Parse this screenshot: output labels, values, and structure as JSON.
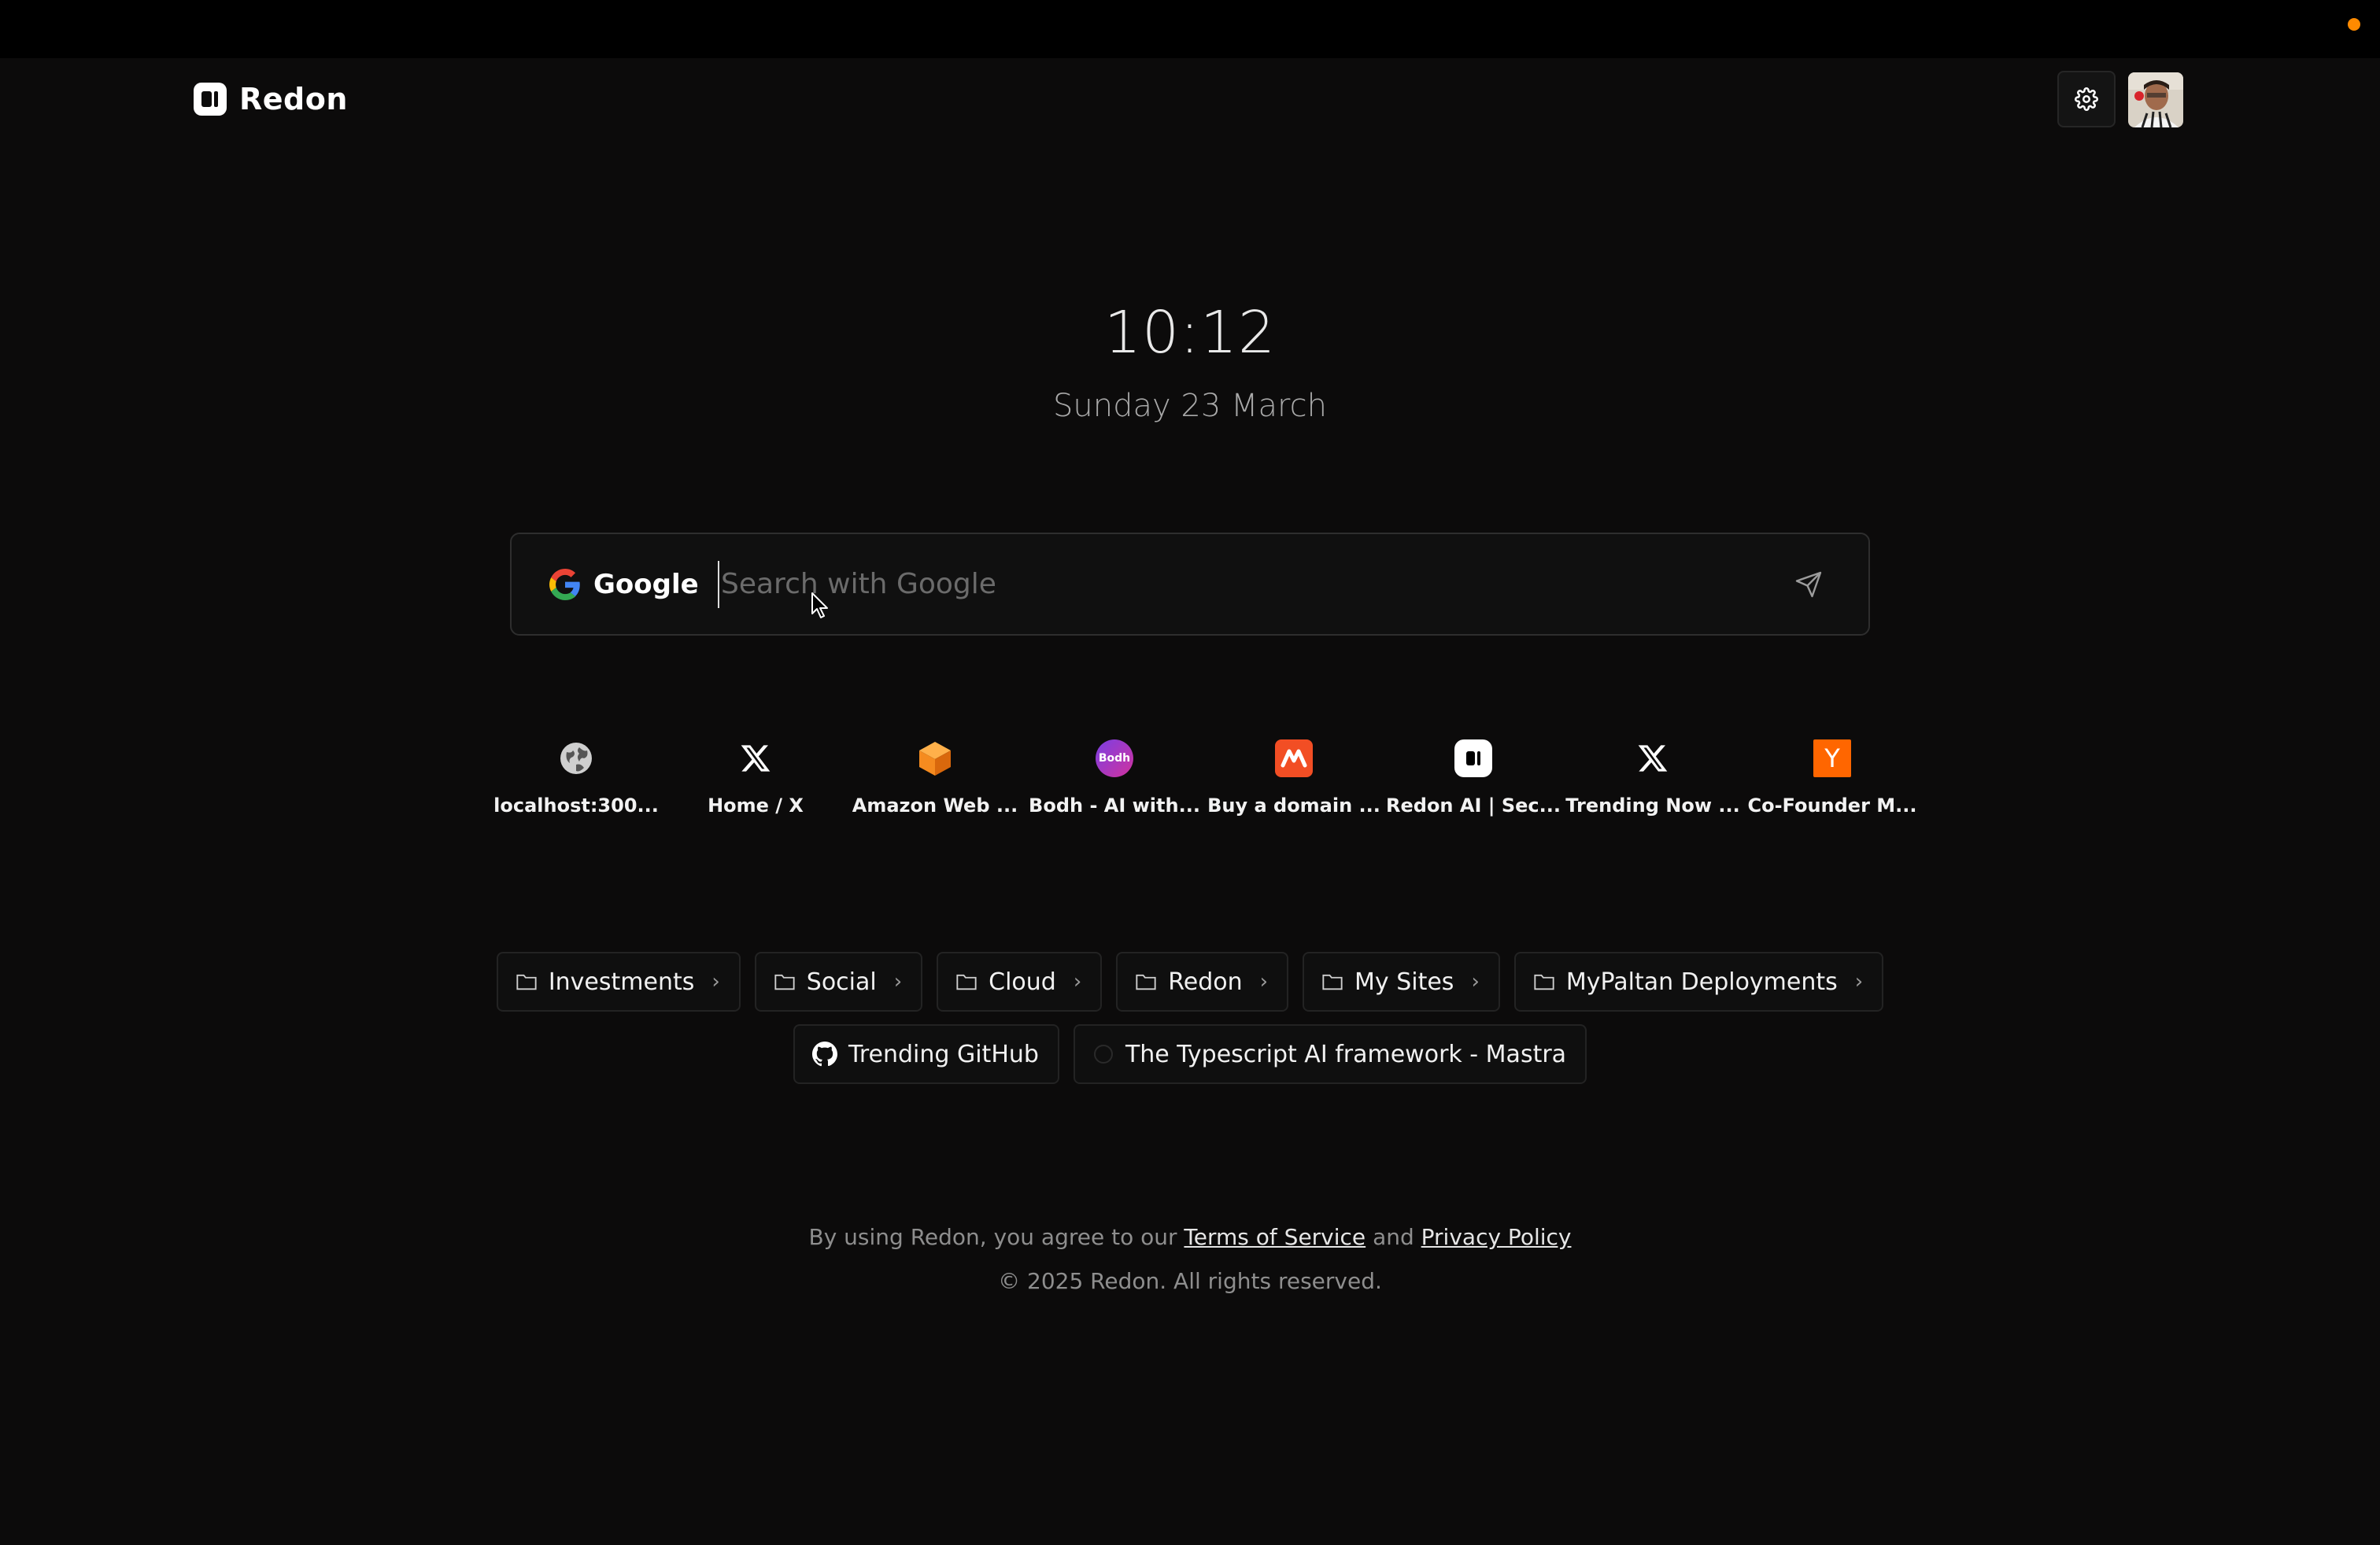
{
  "app": {
    "name": "Redon"
  },
  "clock": {
    "time": "10:12",
    "date": "Sunday 23 March"
  },
  "search": {
    "engine": "Google",
    "placeholder": "Search with Google",
    "value": ""
  },
  "shortcuts": [
    {
      "label": "localhost:300...",
      "icon": "globe-icon"
    },
    {
      "label": "Home / X",
      "icon": "x-logo-icon"
    },
    {
      "label": "Amazon Web ...",
      "icon": "aws-cube-icon"
    },
    {
      "label": "Bodh - AI with...",
      "icon": "bodh-icon",
      "icon_text": "Bodh"
    },
    {
      "label": "Buy a domain ...",
      "icon": "namecheap-icon"
    },
    {
      "label": "Redon AI | Sec...",
      "icon": "redon-icon"
    },
    {
      "label": "Trending Now ...",
      "icon": "x-logo-icon"
    },
    {
      "label": "Co-Founder M...",
      "icon": "ycombinator-icon",
      "icon_text": "Y"
    }
  ],
  "folders": [
    {
      "label": "Investments"
    },
    {
      "label": "Social"
    },
    {
      "label": "Cloud"
    },
    {
      "label": "Redon"
    },
    {
      "label": "My Sites"
    },
    {
      "label": "MyPaltan Deployments"
    }
  ],
  "links": [
    {
      "label": "Trending GitHub",
      "icon": "github-icon"
    },
    {
      "label": "The Typescript AI framework - Mastra",
      "icon": "mastra-icon"
    }
  ],
  "footer": {
    "agree_prefix": "By using Redon, you agree to our",
    "terms": "Terms of Service",
    "and": "and",
    "privacy": "Privacy Policy",
    "copyright": "© 2025 Redon. All rights reserved."
  },
  "colors": {
    "background": "#0c0b0b",
    "accent_dot": "#ff8a00",
    "aws": "#f58b1f",
    "ycombinator": "#ff6600",
    "namecheap": "#f24e24"
  }
}
